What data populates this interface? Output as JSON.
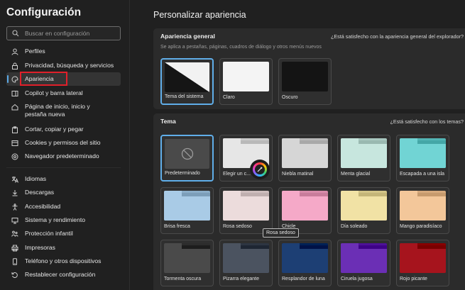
{
  "sidebar": {
    "title": "Configuración",
    "search_placeholder": "Buscar en configuración",
    "items": [
      {
        "label": "Perfiles",
        "icon": "person-icon"
      },
      {
        "label": "Privacidad, búsqueda y servicios",
        "icon": "lock-icon"
      },
      {
        "label": "Apariencia",
        "icon": "palette-icon"
      },
      {
        "label": "Copilot y barra lateral",
        "icon": "sidebar-icon"
      },
      {
        "label": "Página de inicio, inicio y pestaña nueva",
        "icon": "home-icon"
      },
      {
        "label": "Cortar, copiar y pegar",
        "icon": "clipboard-icon"
      },
      {
        "label": "Cookies y permisos del sitio",
        "icon": "cookie-icon"
      },
      {
        "label": "Navegador predeterminado",
        "icon": "browser-icon"
      },
      {
        "label": "Idiomas",
        "icon": "language-icon"
      },
      {
        "label": "Descargas",
        "icon": "download-icon"
      },
      {
        "label": "Accesibilidad",
        "icon": "accessibility-icon"
      },
      {
        "label": "Sistema y rendimiento",
        "icon": "system-icon"
      },
      {
        "label": "Protección infantil",
        "icon": "family-icon"
      },
      {
        "label": "Impresoras",
        "icon": "printer-icon"
      },
      {
        "label": "Teléfono y otros dispositivos",
        "icon": "phone-icon"
      },
      {
        "label": "Restablecer configuración",
        "icon": "reset-icon"
      }
    ]
  },
  "main": {
    "title": "Personalizar apariencia",
    "general": {
      "heading": "Apariencia general",
      "feedback": "¿Está satisfecho con la apariencia general del explorador?",
      "subtitle": "Se aplica a pestañas, páginas, cuadros de diálogo y otros menús nuevos",
      "options": [
        "Tema del sistema",
        "Claro",
        "Oscuro"
      ]
    },
    "theme": {
      "heading": "Tema",
      "feedback": "¿Está satisfecho con los temas?",
      "tooltip": "Rosa sedoso",
      "tiles": [
        {
          "label": "Predeterminado"
        },
        {
          "label": "Elegir un c...",
          "color": "#e6e6e6"
        },
        {
          "label": "Niebla matinal",
          "color": "#d6d6d6"
        },
        {
          "label": "Menta glacial",
          "color": "#c7e6de"
        },
        {
          "label": "Escapada a una isla",
          "color": "#71d4d4"
        },
        {
          "label": "Brisa fresca",
          "color": "#a9cbe6"
        },
        {
          "label": "Rosa sedoso",
          "color": "#ecdcdc"
        },
        {
          "label": "Chicle",
          "color": "#f5a9c8"
        },
        {
          "label": "Día soleado",
          "color": "#f1e2a5"
        },
        {
          "label": "Mango paradisíaco",
          "color": "#f3c79a"
        },
        {
          "label": "Tormenta oscura",
          "color": "#4a4a4a"
        },
        {
          "label": "Pizarra elegante",
          "color": "#4b5360"
        },
        {
          "label": "Resplandor de luna",
          "color": "#1d3f74"
        },
        {
          "label": "Ciruela jugosa",
          "color": "#6b2fb5"
        },
        {
          "label": "Rojo picante",
          "color": "#a6141d"
        }
      ]
    }
  }
}
